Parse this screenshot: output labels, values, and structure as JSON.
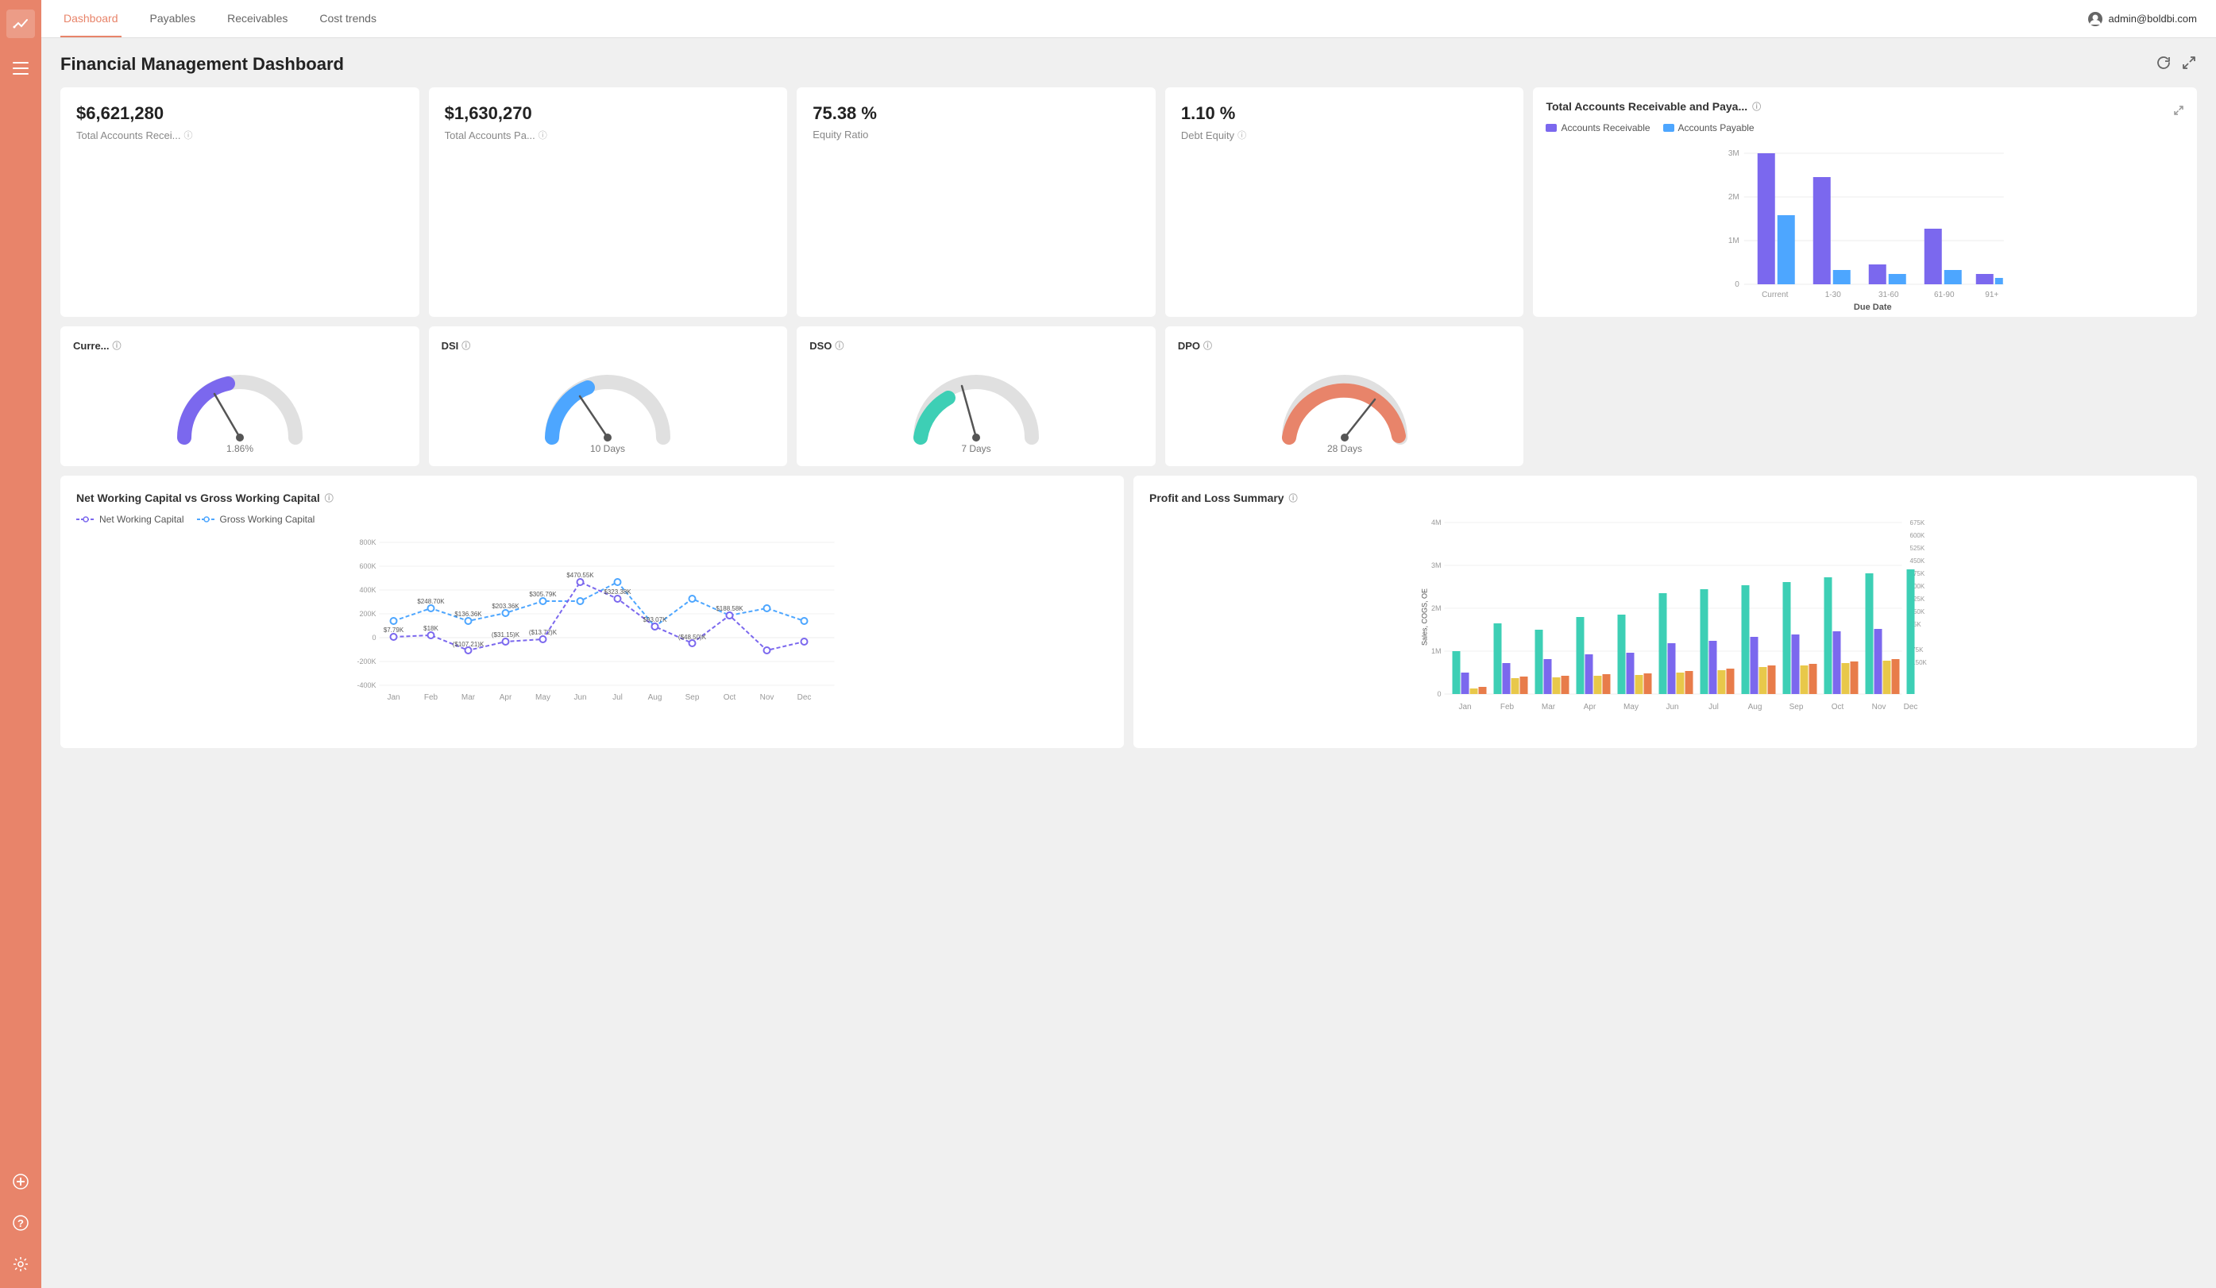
{
  "app": {
    "title": "Financial Management Dashboard"
  },
  "nav": {
    "items": [
      {
        "label": "Dashboard",
        "active": true
      },
      {
        "label": "Payables",
        "active": false
      },
      {
        "label": "Receivables",
        "active": false
      },
      {
        "label": "Cost trends",
        "active": false
      }
    ],
    "user": "admin@boldbi.com"
  },
  "kpi": [
    {
      "value": "$6,621,280",
      "label": "Total Accounts Recei...",
      "info": true
    },
    {
      "value": "$1,630,270",
      "label": "Total Accounts Pa...",
      "info": true
    },
    {
      "value": "75.38 %",
      "label": "Equity Ratio",
      "info": false
    },
    {
      "value": "1.10 %",
      "label": "Debt Equity",
      "info": true
    }
  ],
  "gauges": [
    {
      "title": "Curre...",
      "info": true,
      "value": "1.86%",
      "color": "#7b68ee",
      "percent": 0.25
    },
    {
      "title": "DSI",
      "info": true,
      "value": "10 Days",
      "color": "#4da6ff",
      "percent": 0.18
    },
    {
      "title": "DSO",
      "info": true,
      "value": "7 Days",
      "color": "#3dcfb5",
      "percent": 0.12
    },
    {
      "title": "DPO",
      "info": true,
      "value": "28 Days",
      "color": "#e8846a",
      "percent": 0.6
    }
  ],
  "ar_ap_chart": {
    "title": "Total Accounts Receivable and Paya...",
    "legend": [
      "Accounts Receivable",
      "Accounts Payable"
    ],
    "colors": [
      "#7b68ee",
      "#4da6ff"
    ],
    "categories": [
      "Current",
      "1-30",
      "31-60",
      "61-90",
      "91+"
    ],
    "ar_values": [
      2600,
      2100,
      400,
      1100,
      200
    ],
    "ap_values": [
      1400,
      300,
      200,
      300,
      100
    ],
    "y_labels": [
      "3M",
      "2M",
      "1M",
      "0"
    ]
  },
  "working_capital": {
    "title": "Net Working Capital vs Gross Working Capital",
    "legend": [
      "Net Working Capital",
      "Gross Working Capital"
    ],
    "months": [
      "Jan",
      "Feb",
      "Mar",
      "Apr",
      "May",
      "Jun",
      "Jul",
      "Aug",
      "Sep",
      "Oct",
      "Nov",
      "Dec"
    ],
    "net": [
      7.79,
      18,
      -107.21,
      -31.15,
      -13.72,
      470.55,
      323.38,
      93.07,
      -48.5,
      188.58,
      -107.21,
      -31.15
    ],
    "gross": [
      136.36,
      248.7,
      136.36,
      203.36,
      305.79,
      305.79,
      470.55,
      93.07,
      323.38,
      188.58,
      248.7,
      136.36
    ],
    "net_labels": [
      "$7.79K",
      "$18K",
      "($107.21)K",
      "($31.15)K",
      "($13.72)K",
      "$470.55K",
      "$323.38K",
      "$93.07K",
      "($48.50)K",
      "$188.58K",
      "",
      ""
    ],
    "gross_labels": [
      "",
      "$248.70K",
      "$136.36K",
      "$203.36K",
      "$305.79K",
      "",
      "",
      "",
      "",
      "",
      "",
      ""
    ],
    "y_labels": [
      "800K",
      "600K",
      "400K",
      "200K",
      "0",
      "-200K",
      "-400K"
    ]
  },
  "profit_loss": {
    "title": "Profit and Loss Summary",
    "months": [
      "Jan",
      "Feb",
      "Mar",
      "Apr",
      "May",
      "Jun",
      "Jul",
      "Aug",
      "Sep",
      "Oct",
      "Nov",
      "Dec"
    ],
    "y_left": [
      "4M",
      "3M",
      "2M",
      "1M",
      "0"
    ],
    "y_right": [
      "675K",
      "600K",
      "525K",
      "450K",
      "375K",
      "300K",
      "225K",
      "150K",
      "75K",
      "0",
      "-75K",
      "-150K"
    ],
    "colors": {
      "sales": "#3dcfb5",
      "cogs": "#7b68ee",
      "oe": "#e8c84a",
      "profit": "#e87c4a"
    }
  }
}
